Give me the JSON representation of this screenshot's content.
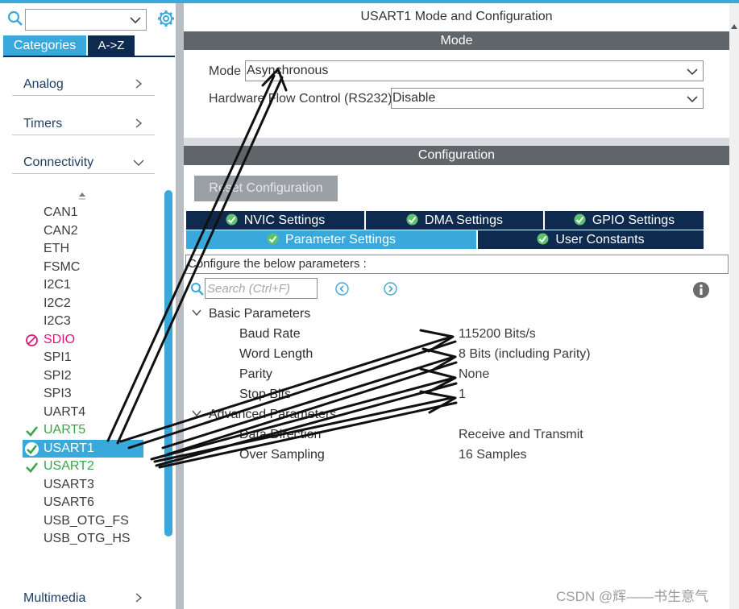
{
  "left_panel": {
    "tabs": {
      "categories": "Categories",
      "a_to_z": "A->Z"
    },
    "categories": {
      "analog": "Analog",
      "timers": "Timers",
      "connectivity": "Connectivity",
      "multimedia": "Multimedia"
    },
    "peripherals": [
      "CAN1",
      "CAN2",
      "ETH",
      "FSMC",
      "I2C1",
      "I2C2",
      "I2C3",
      "SDIO",
      "SPI1",
      "SPI2",
      "SPI3",
      "UART4",
      "UART5",
      "USART1",
      "USART2",
      "USART3",
      "USART6",
      "USB_OTG_FS",
      "USB_OTG_HS"
    ]
  },
  "right_panel": {
    "title": "USART1 Mode and Configuration",
    "mode_header": "Mode",
    "mode": {
      "label": "Mode",
      "value": "Asynchronous"
    },
    "flow_control": {
      "label": "Hardware Flow Control (RS232)",
      "value": "Disable"
    },
    "config_header": "Configuration",
    "reset_button": "Reset Configuration",
    "tabs": {
      "nvic": "NVIC Settings",
      "dma": "DMA Settings",
      "gpio": "GPIO Settings",
      "parameter": "Parameter Settings",
      "user_constants": "User Constants"
    },
    "description": "Configure the below parameters :",
    "search_placeholder": "Search (Ctrl+F)",
    "basic_group": "Basic Parameters",
    "basic_params": [
      {
        "name": "Baud Rate",
        "value": "115200 Bits/s"
      },
      {
        "name": "Word Length",
        "value": "8 Bits (including Parity)"
      },
      {
        "name": "Parity",
        "value": "None"
      },
      {
        "name": "Stop Bits",
        "value": "1"
      }
    ],
    "advanced_group": "Advanced Parameters",
    "advanced_params": [
      {
        "name": "Data Direction",
        "value": "Receive and Transmit"
      },
      {
        "name": "Over Sampling",
        "value": "16 Samples"
      }
    ]
  },
  "watermark": "CSDN @辉——书生意气",
  "colors": {
    "accent": "#39a8db",
    "dark_navy": "#0e2a4f",
    "header_gray": "#606569",
    "enabled_green": "#3aa54a",
    "disabled_pink": "#e0157a"
  }
}
